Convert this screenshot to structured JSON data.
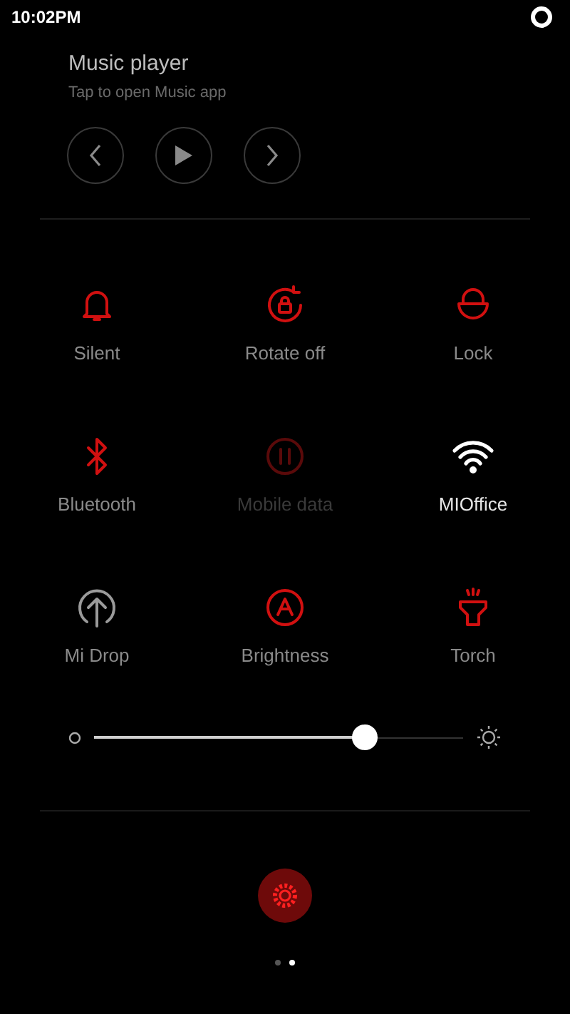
{
  "status_bar": {
    "time": "10:02PM"
  },
  "music": {
    "title": "Music player",
    "subtitle": "Tap to open Music app"
  },
  "tiles": [
    {
      "kind": "bell",
      "label": "Silent",
      "on": true,
      "disabled": false
    },
    {
      "kind": "rotate",
      "label": "Rotate off",
      "on": true,
      "disabled": false
    },
    {
      "kind": "lock",
      "label": "Lock",
      "on": true,
      "disabled": false
    },
    {
      "kind": "bluetooth",
      "label": "Bluetooth",
      "on": true,
      "disabled": false
    },
    {
      "kind": "data",
      "label": "Mobile data",
      "on": true,
      "disabled": true
    },
    {
      "kind": "wifi",
      "label": "MIOffice",
      "on": true,
      "disabled": false
    },
    {
      "kind": "drop",
      "label": "Mi Drop",
      "on": false,
      "disabled": false
    },
    {
      "kind": "brightness",
      "label": "Brightness",
      "on": true,
      "disabled": false
    },
    {
      "kind": "torch",
      "label": "Torch",
      "on": true,
      "disabled": false
    }
  ],
  "brightness_slider": {
    "level": 0.735
  },
  "pages": [
    {
      "selected": false
    },
    {
      "selected": true
    }
  ]
}
